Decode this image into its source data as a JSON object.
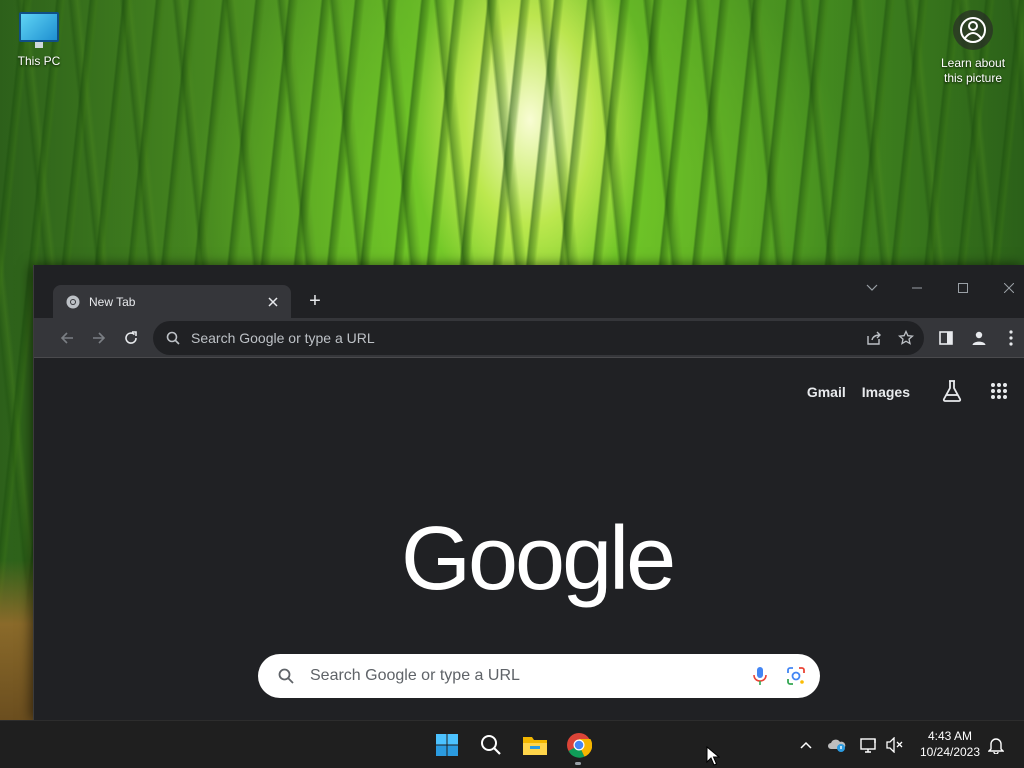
{
  "desktop": {
    "icons": [
      {
        "label": "This PC",
        "icon": "monitor-icon"
      }
    ],
    "spotlight": {
      "label_line1": "Learn about",
      "label_line2": "this picture",
      "icon": "camera-icon"
    }
  },
  "browser": {
    "tabs": [
      {
        "title": "New Tab",
        "favicon": "chrome-icon",
        "active": true
      }
    ],
    "new_tab_label": "+",
    "omnibox": {
      "placeholder": "Search Google or type a URL"
    },
    "toolbar_icons": [
      "back-icon",
      "forward-icon",
      "reload-icon",
      "share-icon",
      "star-icon",
      "sidepanel-icon",
      "profile-icon",
      "menu-icon"
    ],
    "window_controls": [
      "tab-search-icon",
      "minimize-icon",
      "maximize-icon",
      "close-icon"
    ],
    "page": {
      "links": {
        "gmail": "Gmail",
        "images": "Images"
      },
      "logo": "Google",
      "search_placeholder": "Search Google or type a URL"
    }
  },
  "taskbar": {
    "apps": [
      "windows-start-icon",
      "search-icon",
      "file-explorer-icon",
      "chrome-icon"
    ],
    "tray": [
      "chevron-up-icon",
      "onedrive-icon",
      "network-icon",
      "volume-mute-icon",
      "notification-icon"
    ],
    "time": "4:43 AM",
    "date": "10/24/2023"
  },
  "colors": {
    "browser_bg": "#202124",
    "toolbar_bg": "#35363a",
    "taskbar_bg": "#1f1f1f",
    "text_light": "#e8eaed"
  }
}
